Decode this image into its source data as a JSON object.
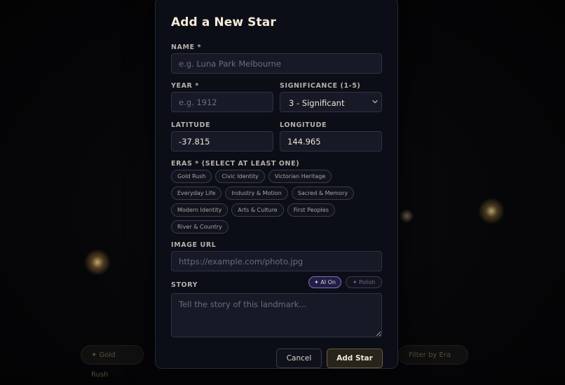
{
  "background": {
    "left_pill": "✦ Gold Rush",
    "right_pill": "Filter by Era"
  },
  "modal": {
    "title": "Add a New Star",
    "name": {
      "label": "NAME *",
      "placeholder": "e.g. Luna Park Melbourne",
      "value": ""
    },
    "year": {
      "label": "YEAR *",
      "placeholder": "e.g. 1912",
      "value": ""
    },
    "significance": {
      "label": "SIGNIFICANCE (1-5)",
      "selected": "3 - Significant"
    },
    "latitude": {
      "label": "LATITUDE",
      "value": "-37.815"
    },
    "longitude": {
      "label": "LONGITUDE",
      "value": "144.965"
    },
    "eras": {
      "label": "ERAS * (SELECT AT LEAST ONE)",
      "rows": [
        [
          "Gold Rush",
          "Civic Identity",
          "Victorian Heritage"
        ],
        [
          "Everyday Life",
          "Industry & Motion",
          "Sacred & Memory"
        ],
        [
          "Modern Identity",
          "Arts & Culture",
          "First Peoples"
        ],
        [
          "River & Country"
        ]
      ]
    },
    "image_url": {
      "label": "IMAGE URL",
      "placeholder": "https://example.com/photo.jpg",
      "value": ""
    },
    "story": {
      "label": "STORY",
      "placeholder": "Tell the story of this landmark...",
      "ai_on_label": "✦ AI On",
      "polish_label": "✦ Polish"
    },
    "cancel_label": "Cancel",
    "add_label": "Add Star"
  },
  "colors": {
    "accent_gold": "#f3ebd8",
    "ai_purple": "#7e6fd3",
    "panel": "#0c0e17"
  }
}
